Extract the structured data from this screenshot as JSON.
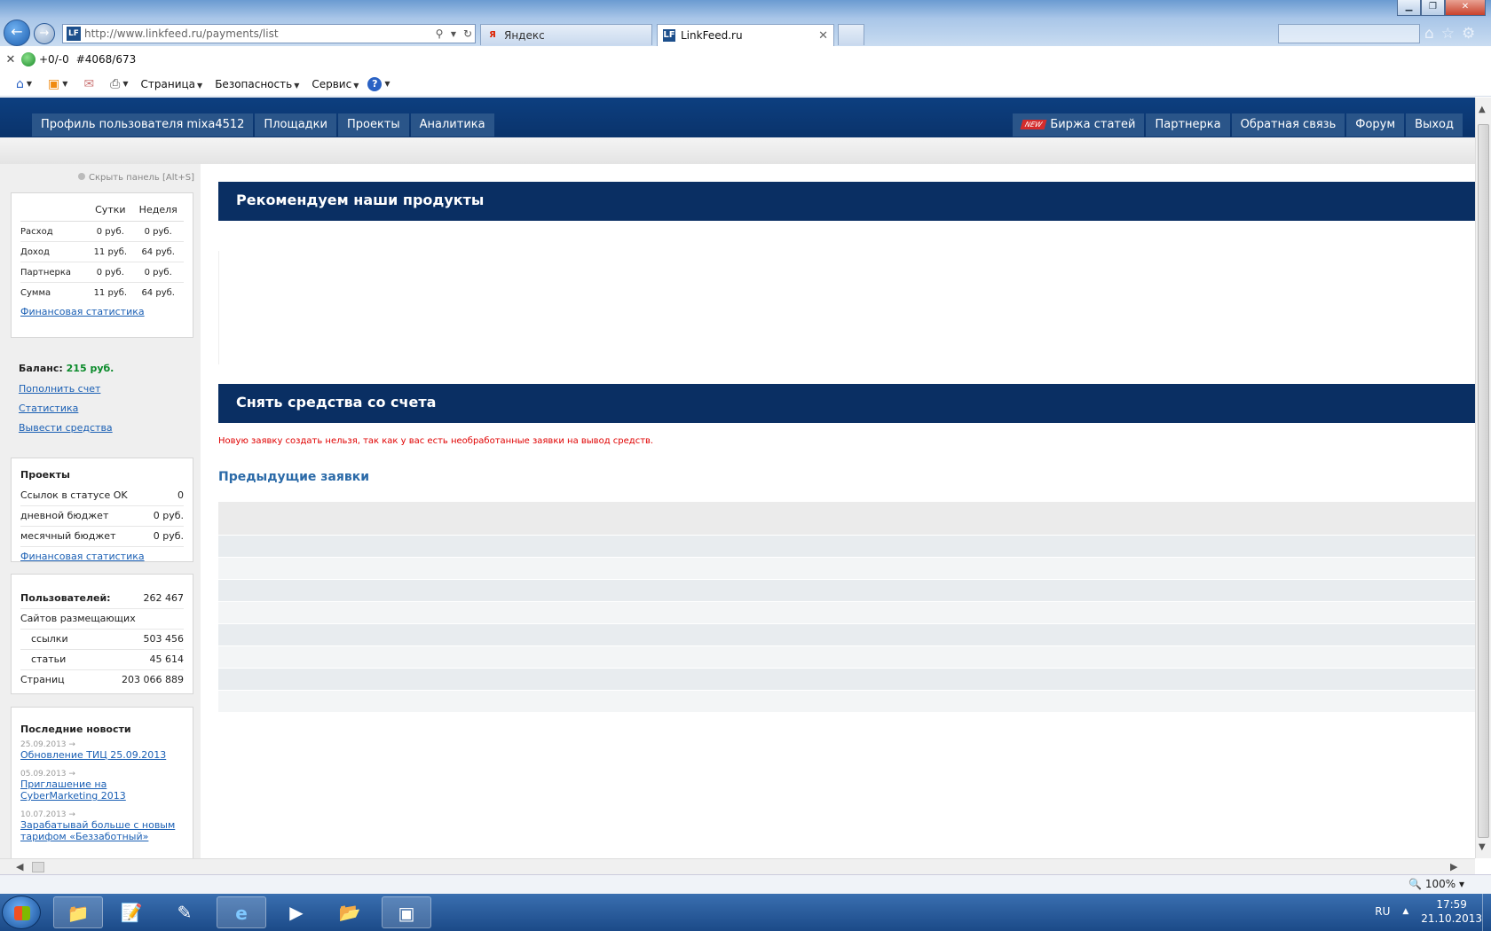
{
  "browser": {
    "url": "http://www.linkfeed.ru/payments/list",
    "tabs": [
      {
        "title": "Яндекс"
      },
      {
        "title": "LinkFeed.ru"
      }
    ],
    "cmd1": {
      "counter": "+0/-0",
      "id": "#4068/673"
    },
    "menu": [
      "Страница",
      "Безопасность",
      "Сервис"
    ],
    "zoom": "100%"
  },
  "site": {
    "nav_left": [
      "Профиль пользователя mixa4512",
      "Площадки",
      "Проекты",
      "Аналитика"
    ],
    "new_badge": "NEW",
    "nav_right": [
      "Биржа статей",
      "Партнерка",
      "Обратная связь",
      "Форум",
      "Выход"
    ]
  },
  "sidebar": {
    "hide_panel": "Скрыть панель [Alt+S]",
    "stats": {
      "headers": [
        "",
        "Сутки",
        "Неделя"
      ],
      "rows": [
        [
          "Расход",
          "0 руб.",
          "0 руб."
        ],
        [
          "Доход",
          "11 руб.",
          "64 руб."
        ],
        [
          "Партнерка",
          "0 руб.",
          "0 руб."
        ],
        [
          "Сумма",
          "11 руб.",
          "64 руб."
        ]
      ],
      "link": "Финансовая статистика"
    },
    "balance": {
      "label": "Баланс:",
      "amount": "215 руб.",
      "links": [
        "Пополнить счет",
        "Статистика",
        "Вывести средства"
      ]
    },
    "projects": {
      "title": "Проекты",
      "rows": [
        [
          "Ссылок в статусе OK",
          "0"
        ],
        [
          "дневной бюджет",
          "0 руб."
        ],
        [
          "месячный бюджет",
          "0 руб."
        ]
      ],
      "link": "Финансовая статистика"
    },
    "users": {
      "rows": [
        [
          "Пользователей:",
          "262 467"
        ],
        [
          "Сайтов размещающих",
          ""
        ],
        [
          "ссылки",
          "503 456"
        ],
        [
          "статьи",
          "45 614"
        ],
        [
          "Страниц",
          "203 066 889"
        ]
      ]
    },
    "news": {
      "title": "Последние новости",
      "items": [
        {
          "date": "25.09.2013",
          "title": "Обновление ТИЦ 25.09.2013"
        },
        {
          "date": "05.09.2013",
          "title": "Приглашение на CyberMarketing 2013"
        },
        {
          "date": "10.07.2013",
          "title": "Зарабатывай больше с новым тарифом «Беззаботный»"
        }
      ]
    }
  },
  "main": {
    "recommend_title": "Рекомендуем наши продукты",
    "withdraw_title": "Снять средства со счета",
    "error_message": "Новую заявку создать нельзя, так как у вас есть необработанные заявки на вывод средств.",
    "previous_title": "Предыдущие заявки"
  },
  "taskbar": {
    "lang": "RU",
    "time": "17:59",
    "date": "21.10.2013"
  }
}
